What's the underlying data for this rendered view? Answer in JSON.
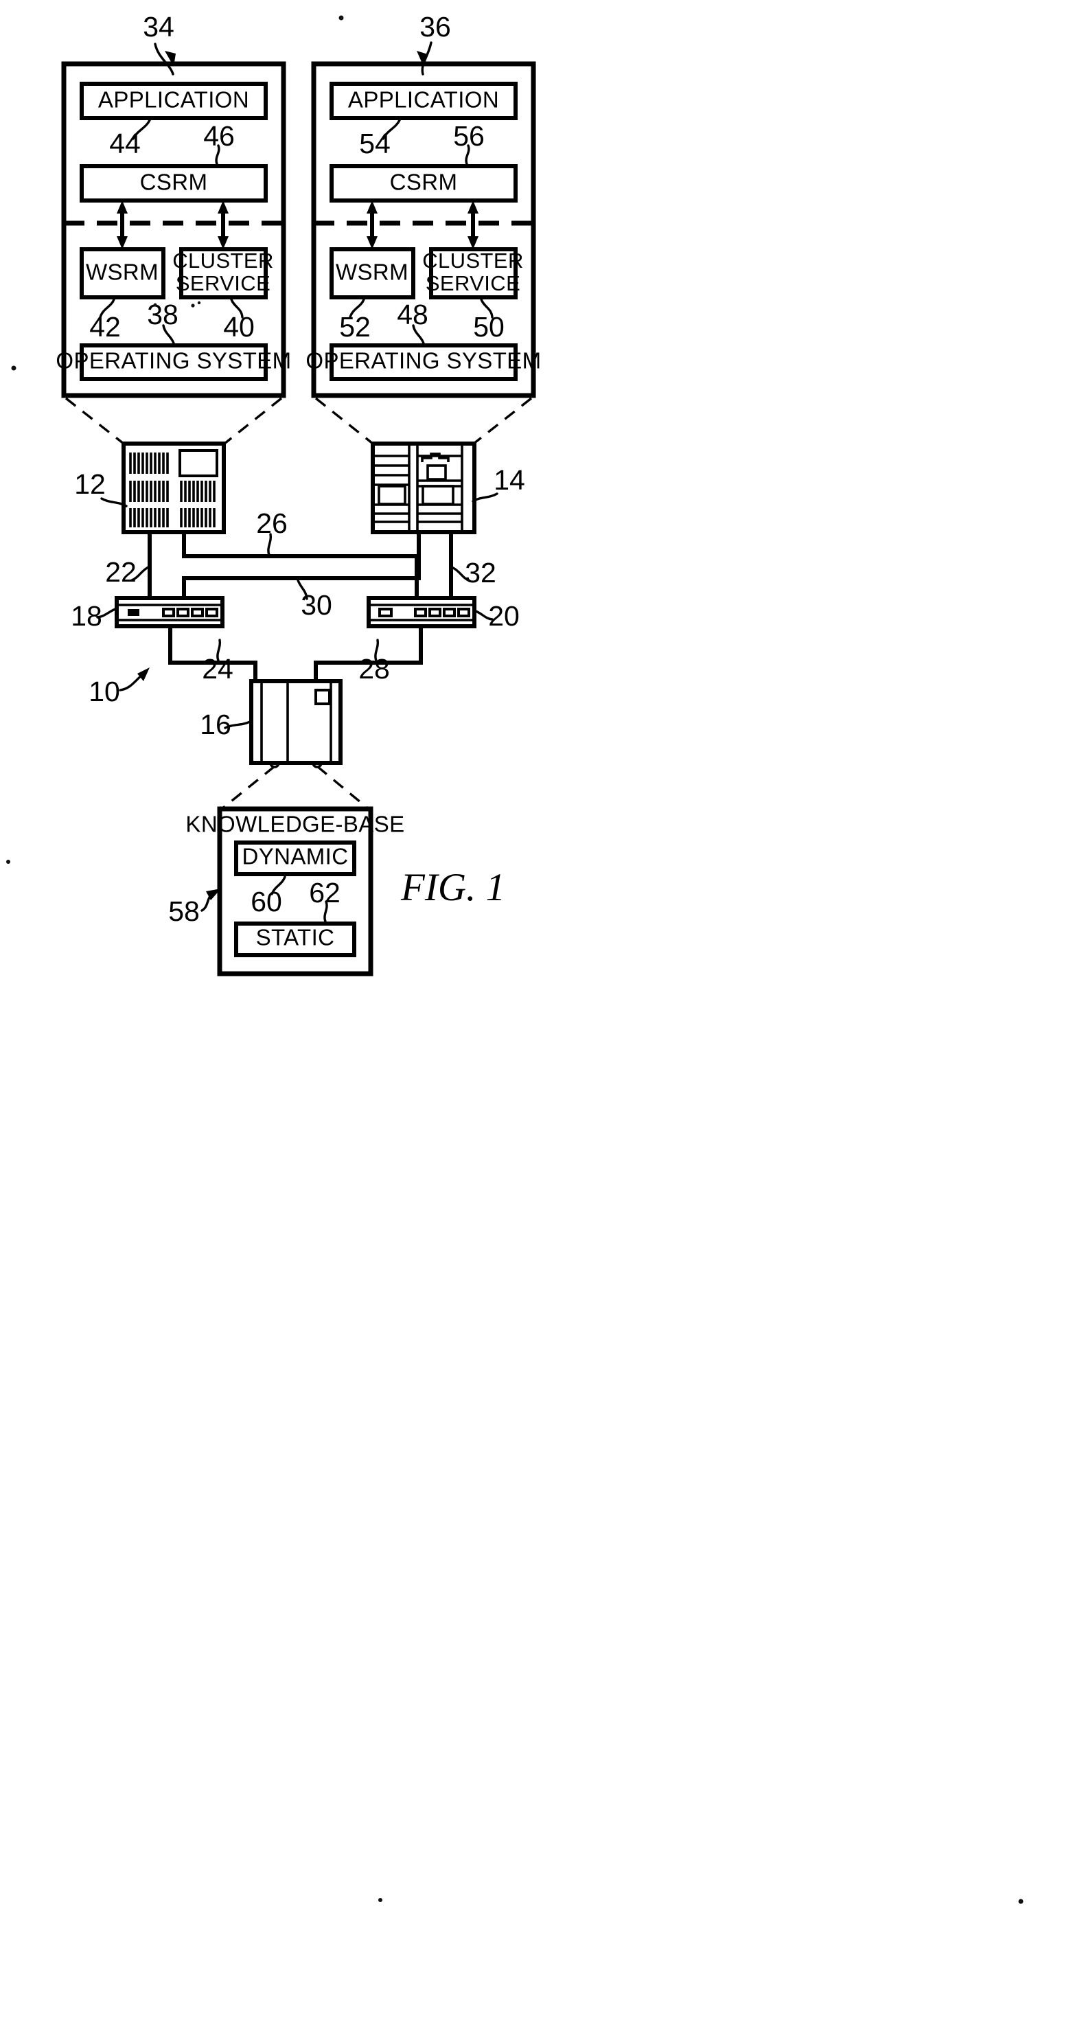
{
  "figure": {
    "caption": "FIG. 1",
    "system_ref": "10"
  },
  "nodes": {
    "left_stack": {
      "ref": "34",
      "boxes": {
        "application": "APPLICATION",
        "csrm": "CSRM",
        "wsrm": "WSRM",
        "cluster_service_line1": "CLUSTER",
        "cluster_service_line2": "SERVICE",
        "operating_system": "OPERATING SYSTEM"
      },
      "refs": {
        "application_link": "44",
        "csrm": "46",
        "wsrm": "42",
        "operating_system": "38",
        "cluster_service": "40"
      }
    },
    "right_stack": {
      "ref": "36",
      "boxes": {
        "application": "APPLICATION",
        "csrm": "CSRM",
        "wsrm": "WSRM",
        "cluster_service_line1": "CLUSTER",
        "cluster_service_line2": "SERVICE",
        "operating_system": "OPERATING SYSTEM"
      },
      "refs": {
        "application_link": "54",
        "csrm": "56",
        "wsrm": "52",
        "operating_system": "48",
        "cluster_service": "50"
      }
    },
    "hardware": {
      "server_left_ref": "12",
      "server_right_ref": "14",
      "storage_ref": "16",
      "switch_left_ref": "18",
      "switch_right_ref": "20"
    },
    "links": {
      "server_left_to_switch_left": "22",
      "switch_left_to_storage": "24",
      "server_left_to_switch_right": "26",
      "switch_right_to_storage": "28",
      "server_right_to_switch_left": "30",
      "server_right_to_switch_right": "32"
    },
    "knowledge_base": {
      "ref": "58",
      "title": "KNOWLEDGE-BASE",
      "dynamic": "DYNAMIC",
      "dynamic_ref": "60",
      "static": "STATIC",
      "static_ref": "62"
    }
  },
  "colors": {
    "ink": "#000000",
    "paper": "#ffffff"
  }
}
